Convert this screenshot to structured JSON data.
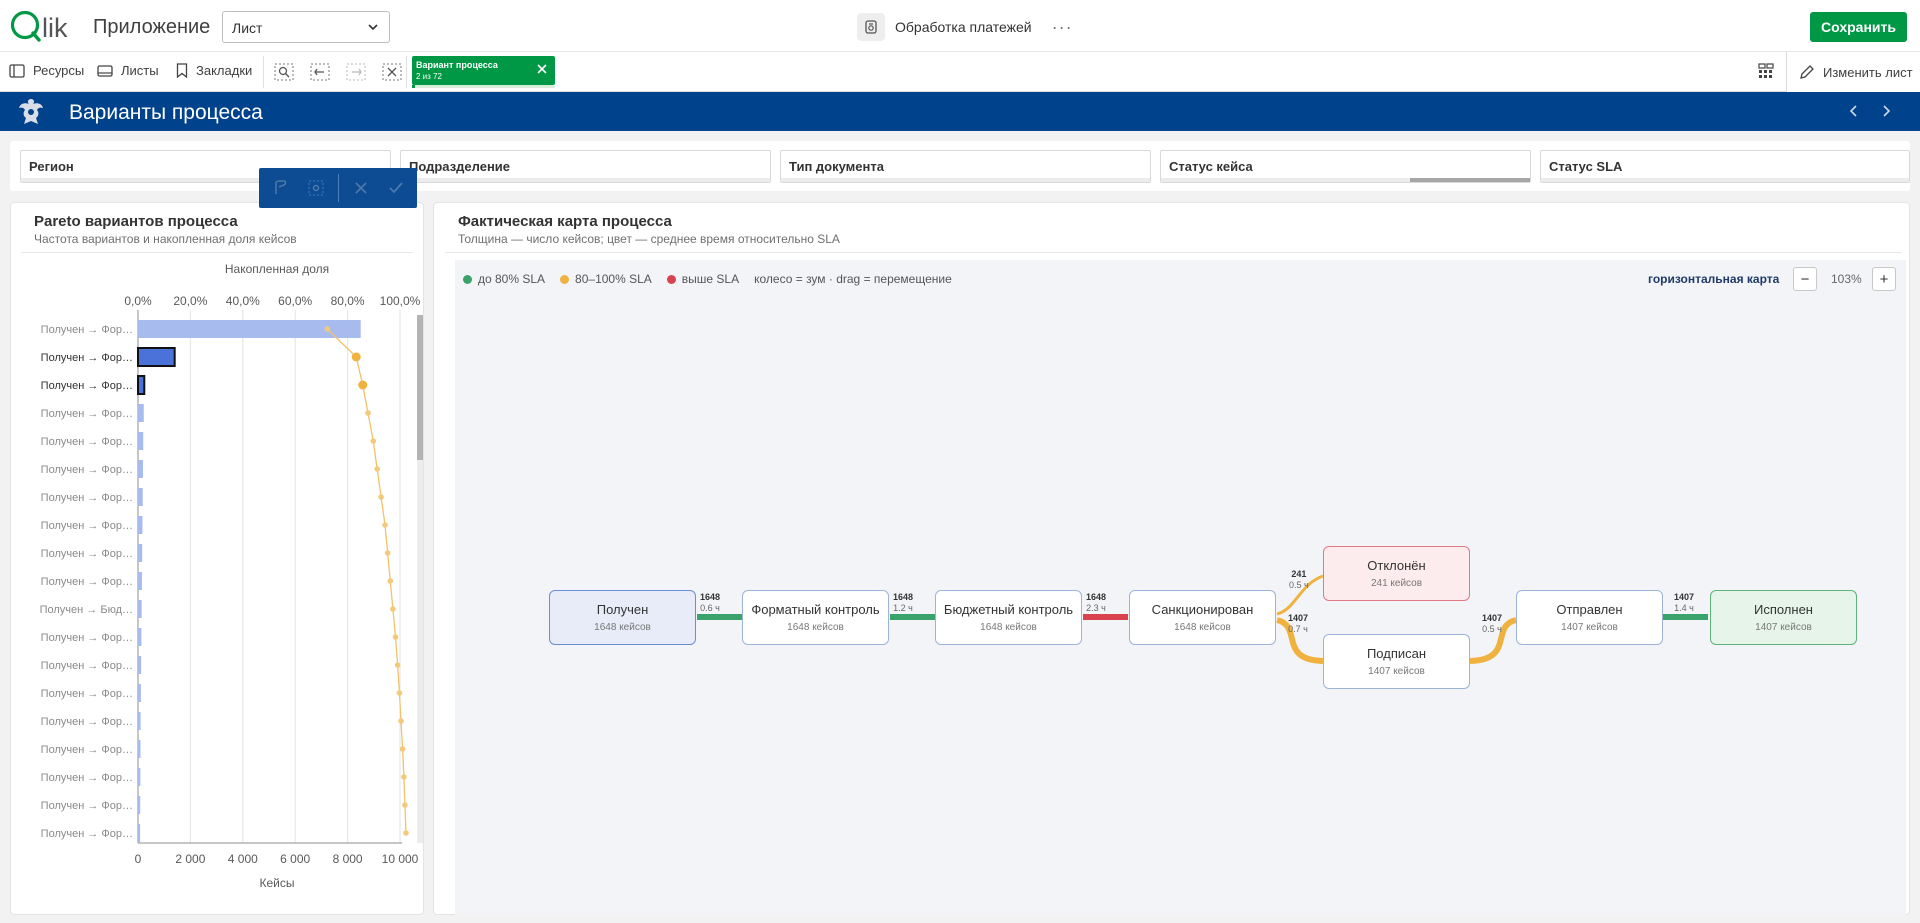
{
  "topbar": {
    "app_label": "Приложение",
    "sheet_select_value": "Лист",
    "center_app_name": "Обработка платежей",
    "more_label": "···",
    "save_label": "Сохранить"
  },
  "toolbar": {
    "resources_label": "Ресурсы",
    "sheets_label": "Листы",
    "bookmarks_label": "Закладки",
    "chip_title": "Вариант процесса",
    "chip_sub": "2 из 72",
    "edit_label": "Изменить лист"
  },
  "sheet": {
    "title": "Варианты процесса"
  },
  "filters": [
    {
      "label": "Регион"
    },
    {
      "label": "Подразделение"
    },
    {
      "label": "Тип документа"
    },
    {
      "label": "Статус кейса"
    },
    {
      "label": "Статус SLA"
    }
  ],
  "pareto": {
    "title": "Pareto вариантов процесса",
    "subtitle": "Частота вариантов и накопленная доля кейсов"
  },
  "chart_data": {
    "type": "bar",
    "orientation": "horizontal",
    "top_axis_label": "Накопленная доля",
    "top_ticks": [
      "0,0%",
      "20,0%",
      "40,0%",
      "60,0%",
      "80,0%",
      "100,0%"
    ],
    "bottom_axis_label": "Кейсы",
    "bottom_ticks": [
      "0",
      "2 000",
      "4 000",
      "6 000",
      "8 000",
      "10 000"
    ],
    "xlim": [
      0,
      10000
    ],
    "categories": [
      "Получен → Фор…",
      "Получен → Фор…",
      "Получен → Фор…",
      "Получен → Фор…",
      "Получен → Фор…",
      "Получен → Фор…",
      "Получен → Фор…",
      "Получен → Фор…",
      "Получен → Фор…",
      "Получен → Фор…",
      "Получен → Бюд…",
      "Получен → Фор…",
      "Получен → Фор…",
      "Получен → Фор…",
      "Получен → Фор…",
      "Получен → Фор…",
      "Получен → Фор…",
      "Получен → Фор…",
      "Получен → Фор…"
    ],
    "selected": [
      1,
      2
    ],
    "series": [
      {
        "name": "Кейсы",
        "values": [
          8500,
          1400,
          240,
          220,
          200,
          190,
          180,
          170,
          160,
          150,
          140,
          130,
          120,
          110,
          100,
          95,
          90,
          85,
          80
        ]
      },
      {
        "name": "Накопленная доля",
        "values": [
          70,
          81,
          83.5,
          85.5,
          87.5,
          89,
          90.5,
          92,
          93,
          94,
          95,
          96,
          96.8,
          97.5,
          98.1,
          98.7,
          99.2,
          99.6,
          100
        ]
      }
    ]
  },
  "processmap": {
    "title": "Фактическая карта процесса",
    "subtitle": "Толщина — число кейсов; цвет — среднее время относительно SLA",
    "legend": [
      {
        "label": "до 80% SLA",
        "color": "#3aa36b"
      },
      {
        "label": "80–100% SLA",
        "color": "#f0b23e"
      },
      {
        "label": "выше SLA",
        "color": "#d9434f"
      }
    ],
    "hint": "колесо = зум · drag = перемещение",
    "orientation_label": "горизонтальная карта",
    "zoom_minus": "−",
    "zoom_plus": "+",
    "zoom_value": "103%",
    "nodes": [
      {
        "name": "Получен",
        "count": "1648 кейсов"
      },
      {
        "name": "Форматный контроль",
        "count": "1648 кейсов"
      },
      {
        "name": "Бюджетный контроль",
        "count": "1648 кейсов"
      },
      {
        "name": "Санкционирован",
        "count": "1648 кейсов"
      },
      {
        "name": "Отклонён",
        "count": "241 кейсов"
      },
      {
        "name": "Подписан",
        "count": "1407 кейсов"
      },
      {
        "name": "Отправлен",
        "count": "1407 кейсов"
      },
      {
        "name": "Исполнен",
        "count": "1407 кейсов"
      }
    ],
    "edges": [
      {
        "cases": "1648",
        "time": "0.6 ч",
        "color": "#3aa36b"
      },
      {
        "cases": "1648",
        "time": "1.2 ч",
        "color": "#3aa36b"
      },
      {
        "cases": "1648",
        "time": "2.3 ч",
        "color": "#d9434f"
      },
      {
        "cases": "241",
        "time": "0.5 ч",
        "color": "#f0b23e"
      },
      {
        "cases": "1407",
        "time": "0.7 ч",
        "color": "#f0b23e"
      },
      {
        "cases": "1407",
        "time": "0.5 ч",
        "color": "#f0b23e"
      },
      {
        "cases": "1407",
        "time": "1.4 ч",
        "color": "#3aa36b"
      }
    ]
  }
}
